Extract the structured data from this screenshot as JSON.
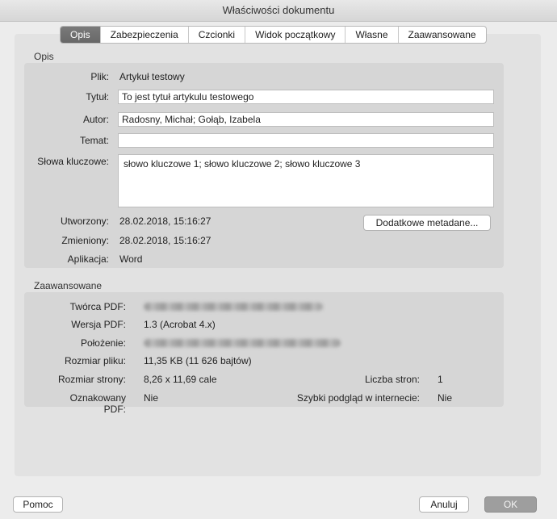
{
  "window": {
    "title": "Właściwości dokumentu"
  },
  "tabs": [
    {
      "label": "Opis",
      "active": true
    },
    {
      "label": "Zabezpieczenia",
      "active": false
    },
    {
      "label": "Czcionki",
      "active": false
    },
    {
      "label": "Widok początkowy",
      "active": false
    },
    {
      "label": "Własne",
      "active": false
    },
    {
      "label": "Zaawansowane",
      "active": false
    }
  ],
  "description": {
    "section_title": "Opis",
    "file_label": "Plik:",
    "file_value": "Artykuł testowy",
    "title_label": "Tytuł:",
    "title_value": "To jest tytuł artykulu testowego",
    "author_label": "Autor:",
    "author_value": "Radosny, Michał; Gołąb, Izabela",
    "subject_label": "Temat:",
    "subject_value": "",
    "keywords_label": "Słowa kluczowe:",
    "keywords_value": "słowo kluczowe 1; słowo kluczowe 2; słowo kluczowe 3",
    "created_label": "Utworzony:",
    "created_value": "28.02.2018, 15:16:27",
    "modified_label": "Zmieniony:",
    "modified_value": "28.02.2018, 15:16:27",
    "application_label": "Aplikacja:",
    "application_value": "Word",
    "metadata_button": "Dodatkowe metadane..."
  },
  "advanced": {
    "section_title": "Zaawansowane",
    "producer_label": "Twórca PDF:",
    "version_label": "Wersja PDF:",
    "version_value": "1.3 (Acrobat 4.x)",
    "location_label": "Położenie:",
    "size_label": "Rozmiar pliku:",
    "size_value": "11,35 KB (11 626 bajtów)",
    "page_size_label": "Rozmiar strony:",
    "page_size_value": "8,26 x 11,69 cale",
    "page_count_label": "Liczba stron:",
    "page_count_value": "1",
    "tagged_label": "Oznakowany PDF:",
    "tagged_value": "Nie",
    "fast_web_label": "Szybki podgląd w internecie:",
    "fast_web_value": "Nie"
  },
  "footer": {
    "help_button": "Pomoc",
    "cancel_button": "Anuluj",
    "ok_button": "OK"
  }
}
